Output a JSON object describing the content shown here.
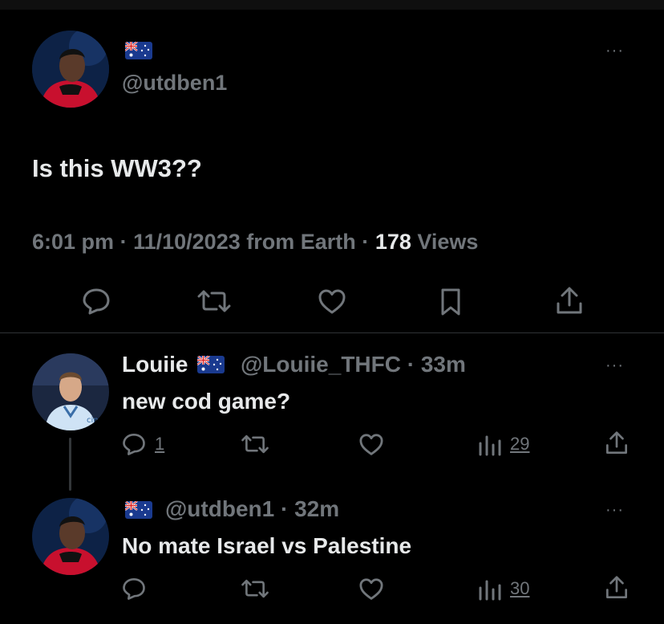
{
  "main_tweet": {
    "handle": "@utdben1",
    "text": "Is this WW3??",
    "time": "6:01 pm",
    "sep1": "·",
    "date": "11/10/2023",
    "source": "from Earth",
    "sep2": "·",
    "views_count": "178",
    "views_label": "Views"
  },
  "replies": [
    {
      "name": "Louiie",
      "handle": "@Louiie_THFC",
      "sep": "·",
      "time": "33m",
      "text": "new cod game?",
      "reply_count": "1",
      "views": "29"
    },
    {
      "handle": "@utdben1",
      "sep": "·",
      "time": "32m",
      "text": "No mate Israel vs Palestine",
      "views": "30"
    }
  ],
  "more_glyph": "···",
  "colors": {
    "background": "#000000",
    "text": "#e7e9ea",
    "muted": "#71767b",
    "divider": "#2f3336"
  }
}
